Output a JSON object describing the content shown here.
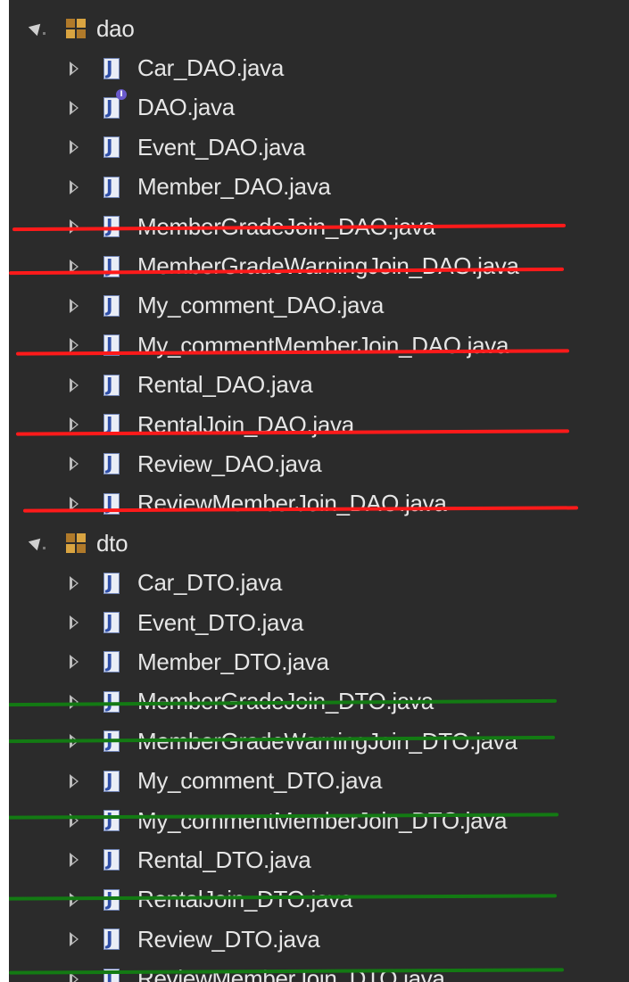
{
  "tree": {
    "packages": [
      {
        "name": "dao",
        "files": [
          {
            "name": "Car_DAO.java",
            "icon": "java-class-icon"
          },
          {
            "name": "DAO.java",
            "icon": "java-interface-icon"
          },
          {
            "name": "Event_DAO.java",
            "icon": "java-class-icon"
          },
          {
            "name": "Member_DAO.java",
            "icon": "java-class-icon"
          },
          {
            "name": "MemberGradeJoin_DAO.java",
            "icon": "java-class-icon"
          },
          {
            "name": "MemberGradeWarningJoin_DAO.java",
            "icon": "java-class-icon"
          },
          {
            "name": "My_comment_DAO.java",
            "icon": "java-class-icon"
          },
          {
            "name": "My_commentMemberJoin_DAO.java",
            "icon": "java-class-icon"
          },
          {
            "name": "Rental_DAO.java",
            "icon": "java-class-icon"
          },
          {
            "name": "RentalJoin_DAO.java",
            "icon": "java-class-icon"
          },
          {
            "name": "Review_DAO.java",
            "icon": "java-class-icon"
          },
          {
            "name": "ReviewMemberJoin_DAO.java",
            "icon": "java-class-icon"
          }
        ]
      },
      {
        "name": "dto",
        "files": [
          {
            "name": "Car_DTO.java",
            "icon": "java-class-icon"
          },
          {
            "name": "Event_DTO.java",
            "icon": "java-class-icon"
          },
          {
            "name": "Member_DTO.java",
            "icon": "java-class-icon"
          },
          {
            "name": "MemberGradeJoin_DTO.java",
            "icon": "java-class-icon"
          },
          {
            "name": "MemberGradeWarningJoin_DTO.java",
            "icon": "java-class-icon"
          },
          {
            "name": "My_comment_DTO.java",
            "icon": "java-class-icon"
          },
          {
            "name": "My_commentMemberJoin_DTO.java",
            "icon": "java-class-icon"
          },
          {
            "name": "Rental_DTO.java",
            "icon": "java-class-icon"
          },
          {
            "name": "RentalJoin_DTO.java",
            "icon": "java-class-icon"
          },
          {
            "name": "Review_DTO.java",
            "icon": "java-class-icon"
          },
          {
            "name": "ReviewMemberJoin_DTO.java",
            "icon": "java-class-icon"
          }
        ]
      }
    ]
  },
  "colors": {
    "background": "#2b2b2b",
    "text": "#e6e6e6",
    "dao_underline": "#ff1a1a",
    "dto_underline": "#137a13"
  }
}
